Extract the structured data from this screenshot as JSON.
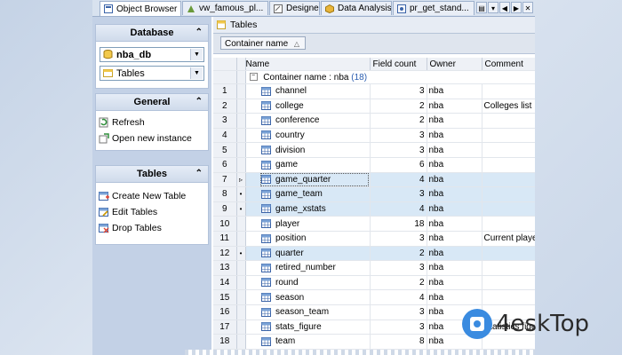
{
  "tabs": [
    {
      "label": "Object Browser",
      "active": true
    },
    {
      "label": "vw_famous_pl..."
    },
    {
      "label": "Designer"
    },
    {
      "label": "Data Analysis"
    },
    {
      "label": "pr_get_stand..."
    }
  ],
  "left": {
    "database": {
      "title": "Database",
      "db_value": "nba_db",
      "type_value": "Tables"
    },
    "general": {
      "title": "General",
      "refresh": "Refresh",
      "new_instance": "Open new instance"
    },
    "tables": {
      "title": "Tables",
      "create": "Create New Table",
      "edit": "Edit Tables",
      "drop": "Drop Tables"
    }
  },
  "right": {
    "title": "Tables",
    "group_chip": "Container name",
    "columns": {
      "name": "Name",
      "field_count": "Field count",
      "owner": "Owner",
      "comment": "Comment"
    },
    "group_label": "Container name : nba",
    "group_count": "(18)",
    "rows": [
      {
        "n": "1",
        "name": "channel",
        "fc": "3",
        "owner": "nba",
        "comment": ""
      },
      {
        "n": "2",
        "name": "college",
        "fc": "2",
        "owner": "nba",
        "comment": "Colleges list"
      },
      {
        "n": "3",
        "name": "conference",
        "fc": "2",
        "owner": "nba",
        "comment": ""
      },
      {
        "n": "4",
        "name": "country",
        "fc": "3",
        "owner": "nba",
        "comment": ""
      },
      {
        "n": "5",
        "name": "division",
        "fc": "3",
        "owner": "nba",
        "comment": ""
      },
      {
        "n": "6",
        "name": "game",
        "fc": "6",
        "owner": "nba",
        "comment": ""
      },
      {
        "n": "7",
        "name": "game_quarter",
        "fc": "4",
        "owner": "nba",
        "comment": ""
      },
      {
        "n": "8",
        "name": "game_team",
        "fc": "3",
        "owner": "nba",
        "comment": ""
      },
      {
        "n": "9",
        "name": "game_xstats",
        "fc": "4",
        "owner": "nba",
        "comment": ""
      },
      {
        "n": "10",
        "name": "player",
        "fc": "18",
        "owner": "nba",
        "comment": ""
      },
      {
        "n": "11",
        "name": "position",
        "fc": "3",
        "owner": "nba",
        "comment": "Current playe"
      },
      {
        "n": "12",
        "name": "quarter",
        "fc": "2",
        "owner": "nba",
        "comment": ""
      },
      {
        "n": "13",
        "name": "retired_number",
        "fc": "3",
        "owner": "nba",
        "comment": ""
      },
      {
        "n": "14",
        "name": "round",
        "fc": "2",
        "owner": "nba",
        "comment": ""
      },
      {
        "n": "15",
        "name": "season",
        "fc": "4",
        "owner": "nba",
        "comment": ""
      },
      {
        "n": "16",
        "name": "season_team",
        "fc": "3",
        "owner": "nba",
        "comment": ""
      },
      {
        "n": "17",
        "name": "stats_figure",
        "fc": "3",
        "owner": "nba",
        "comment": "Statistics figu"
      },
      {
        "n": "18",
        "name": "team",
        "fc": "8",
        "owner": "nba",
        "comment": ""
      }
    ]
  },
  "watermark": "4eskTop",
  "colors": {
    "accent": "#3a8be0",
    "selection": "#d8e8f6",
    "panel": "#c3d1e6"
  }
}
